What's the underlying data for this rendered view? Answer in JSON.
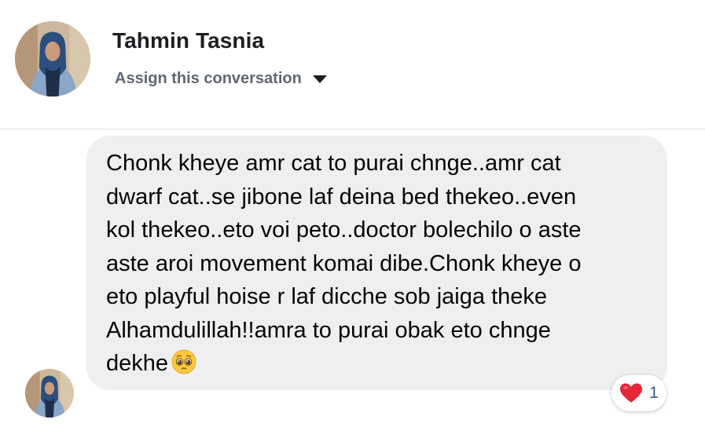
{
  "header": {
    "contact_name": "Tahmin Tasnia",
    "assign_label": "Assign this conversation",
    "assign_icon": "chevron-down-icon"
  },
  "message": {
    "lines": [
      "Chonk kheye amr cat to purai chnge..amr cat",
      "dwarf cat..se jibone laf deina bed thekeo..even",
      "kol thekeo..eto voi peto..doctor bolechilo o aste",
      "aste aroi movement komai dibe.Chonk kheye o",
      "eto playful hoise r laf dicche sob jaiga theke",
      "Alhamdulillah!!amra to purai obak eto chnge",
      "dekhe"
    ],
    "emoji": "pleading-face-icon",
    "reaction": {
      "icon": "heart-icon",
      "count": "1"
    }
  },
  "colors": {
    "bubble_bg": "#efefef",
    "heart": "#e4253a",
    "reaction_count": "#385898"
  }
}
